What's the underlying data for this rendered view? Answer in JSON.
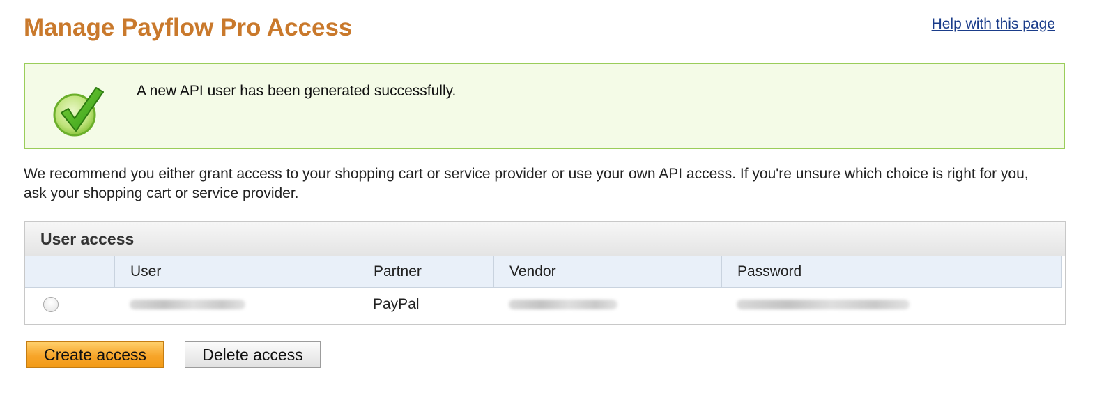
{
  "header": {
    "title": "Manage Payflow Pro Access",
    "help_link": "Help with this page"
  },
  "alert": {
    "type": "success",
    "icon": "checkmark-icon",
    "message": "A new API user has been generated successfully."
  },
  "intro_text": "We recommend you either grant access to your shopping cart or service provider or use your own API access. If you're unsure which choice is right for you, ask your shopping cart or service provider.",
  "user_access": {
    "title": "User access",
    "columns": [
      "User",
      "Partner",
      "Vendor",
      "Password"
    ],
    "rows": [
      {
        "selected": false,
        "partner": "PayPal"
      }
    ]
  },
  "actions": {
    "create_label": "Create access",
    "delete_label": "Delete access"
  },
  "colors": {
    "title": "#c9792c",
    "success_border": "#9acd5a",
    "success_bg": "#f4fbe7",
    "primary_button": "#f7a52a",
    "link": "#1a3c8a"
  }
}
